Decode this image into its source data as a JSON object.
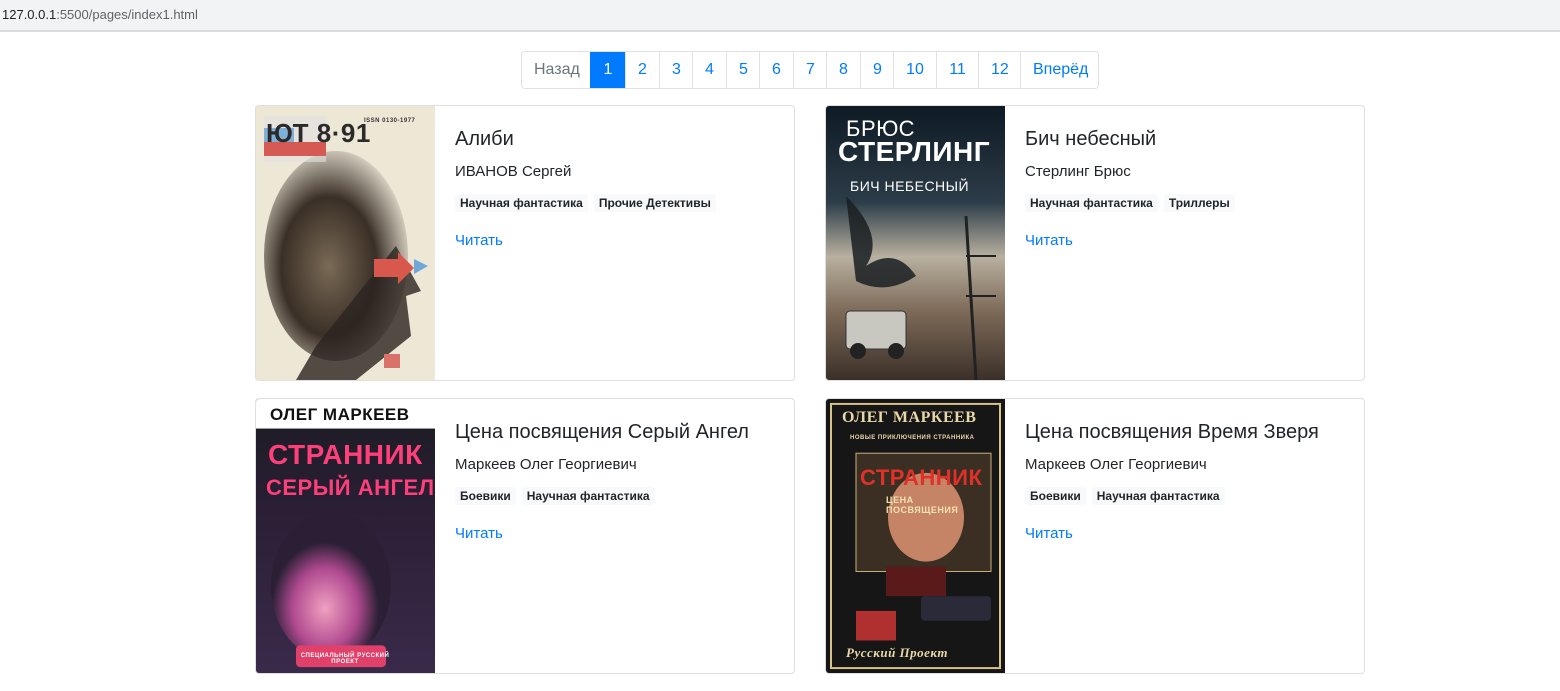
{
  "browser": {
    "url_host": "127.0.0.1",
    "url_path": ":5500/pages/index1.html"
  },
  "pagination": {
    "prev": "Назад",
    "pages": [
      "1",
      "2",
      "3",
      "4",
      "5",
      "6",
      "7",
      "8",
      "9",
      "10",
      "11",
      "12"
    ],
    "active_page": "1",
    "next": "Вперёд"
  },
  "books": [
    {
      "title": "Алиби",
      "author": "ИВАНОВ Сергей",
      "tags": [
        "Научная фантастика",
        "Прочие Детективы"
      ],
      "read_label": "Читать",
      "cover": {
        "top": "ЮТ 8·91",
        "issn": "ISSN 0130-1977"
      }
    },
    {
      "title": "Бич небесный",
      "author": "Стерлинг Брюс",
      "tags": [
        "Научная фантастика",
        "Триллеры"
      ],
      "read_label": "Читать",
      "cover": {
        "line1": "БРЮС",
        "line2": "СТЕРЛИНГ",
        "line3": "БИЧ НЕБЕСНЫЙ"
      }
    },
    {
      "title": "Цена посвящения Серый Ангел",
      "author": "Маркеев Олег Георгиевич",
      "tags": [
        "Боевики",
        "Научная фантастика"
      ],
      "read_label": "Читать",
      "cover": {
        "line1": "ОЛЕГ МАРКЕЕВ",
        "line2": "СТРАННИК",
        "line3": "СЕРЫЙ АНГЕЛ",
        "line4": "СПЕЦИАЛЬНЫЙ РУССКИЙ ПРОЕКТ"
      }
    },
    {
      "title": "Цена посвящения Время Зверя",
      "author": "Маркеев Олег Георгиевич",
      "tags": [
        "Боевики",
        "Научная фантастика"
      ],
      "read_label": "Читать",
      "cover": {
        "line1": "ОЛЕГ МАРКЕЕВ",
        "line2": "НОВЫЕ ПРИКЛЮЧЕНИЯ СТРАННИКА",
        "line3": "СТРАННИК",
        "line4": "ЦЕНА ПОСВЯЩЕНИЯ",
        "line5": "Русский Проект"
      }
    }
  ],
  "colors": {
    "accent": "#007bff",
    "text": "#212529",
    "muted": "#6c757d",
    "border": "#dee2e6"
  }
}
